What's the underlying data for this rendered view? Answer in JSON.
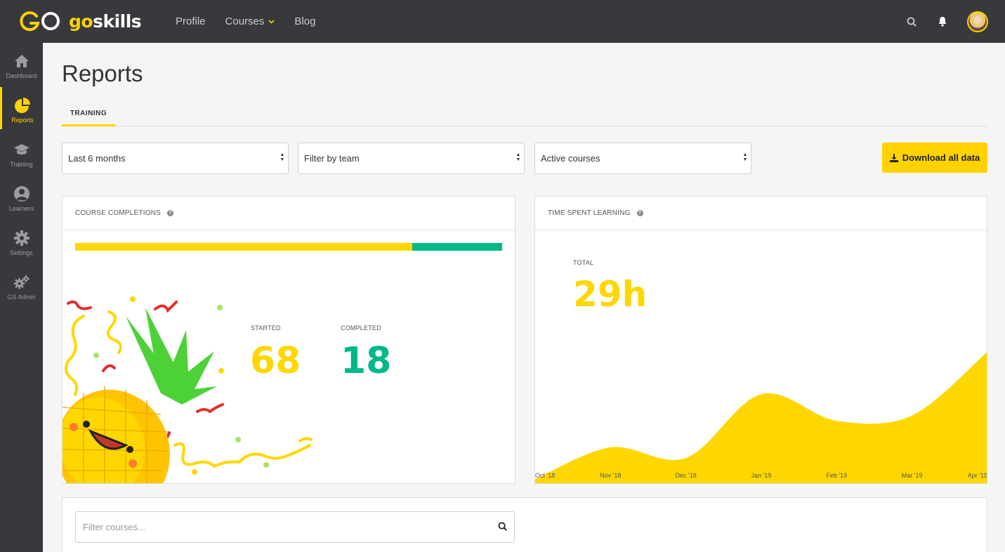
{
  "header": {
    "logo": {
      "go": "go",
      "skills": "skills"
    },
    "nav": [
      {
        "label": "Profile"
      },
      {
        "label": "Courses"
      },
      {
        "label": "Blog"
      }
    ],
    "icons": [
      "search-icon",
      "bell-icon",
      "avatar"
    ]
  },
  "sidebar": {
    "items": [
      {
        "label": "Dashboard",
        "icon": "home-icon"
      },
      {
        "label": "Reports",
        "icon": "pie-chart-icon"
      },
      {
        "label": "Training",
        "icon": "graduation-cap-icon"
      },
      {
        "label": "Learners",
        "icon": "user-icon"
      },
      {
        "label": "Settings",
        "icon": "gear-icon"
      },
      {
        "label": "GS Admin",
        "icon": "gears-icon"
      }
    ],
    "active_index": 1
  },
  "page": {
    "title": "Reports",
    "tabs": [
      {
        "label": "TRAINING"
      }
    ]
  },
  "filters": {
    "period": "Last 6 months",
    "team": "Filter by team",
    "courses": "Active courses",
    "download_label": "Download all data"
  },
  "completions": {
    "title": "COURSE COMPLETIONS",
    "started_label": "STARTED",
    "started_value": "68",
    "completed_label": "COMPLETED",
    "completed_value": "18",
    "progress_fraction_started_only": 0.79,
    "progress_fraction_completed": 0.21
  },
  "time_spent": {
    "title": "TIME SPENT LEARNING",
    "total_label": "TOTAL",
    "total_value": "29h"
  },
  "chart_data": {
    "type": "area",
    "title": "",
    "xlabel": "",
    "ylabel": "",
    "x": [
      "Oct '18",
      "Nov '18",
      "Dec '18",
      "Jan '19",
      "Feb '19",
      "Mar '19",
      "Apr '19"
    ],
    "series": [
      {
        "values": [
          0.5,
          3.5,
          2.5,
          8.5,
          6.0,
          6.5,
          12.5
        ]
      }
    ],
    "ylim": [
      0,
      14
    ],
    "grid": false,
    "color": "#ffd700"
  },
  "course_filter": {
    "placeholder": "Filter courses..."
  },
  "colors": {
    "accent": "#ffd200",
    "started": "#ffd700",
    "completed": "#00b88a",
    "topbar": "#38393c"
  }
}
